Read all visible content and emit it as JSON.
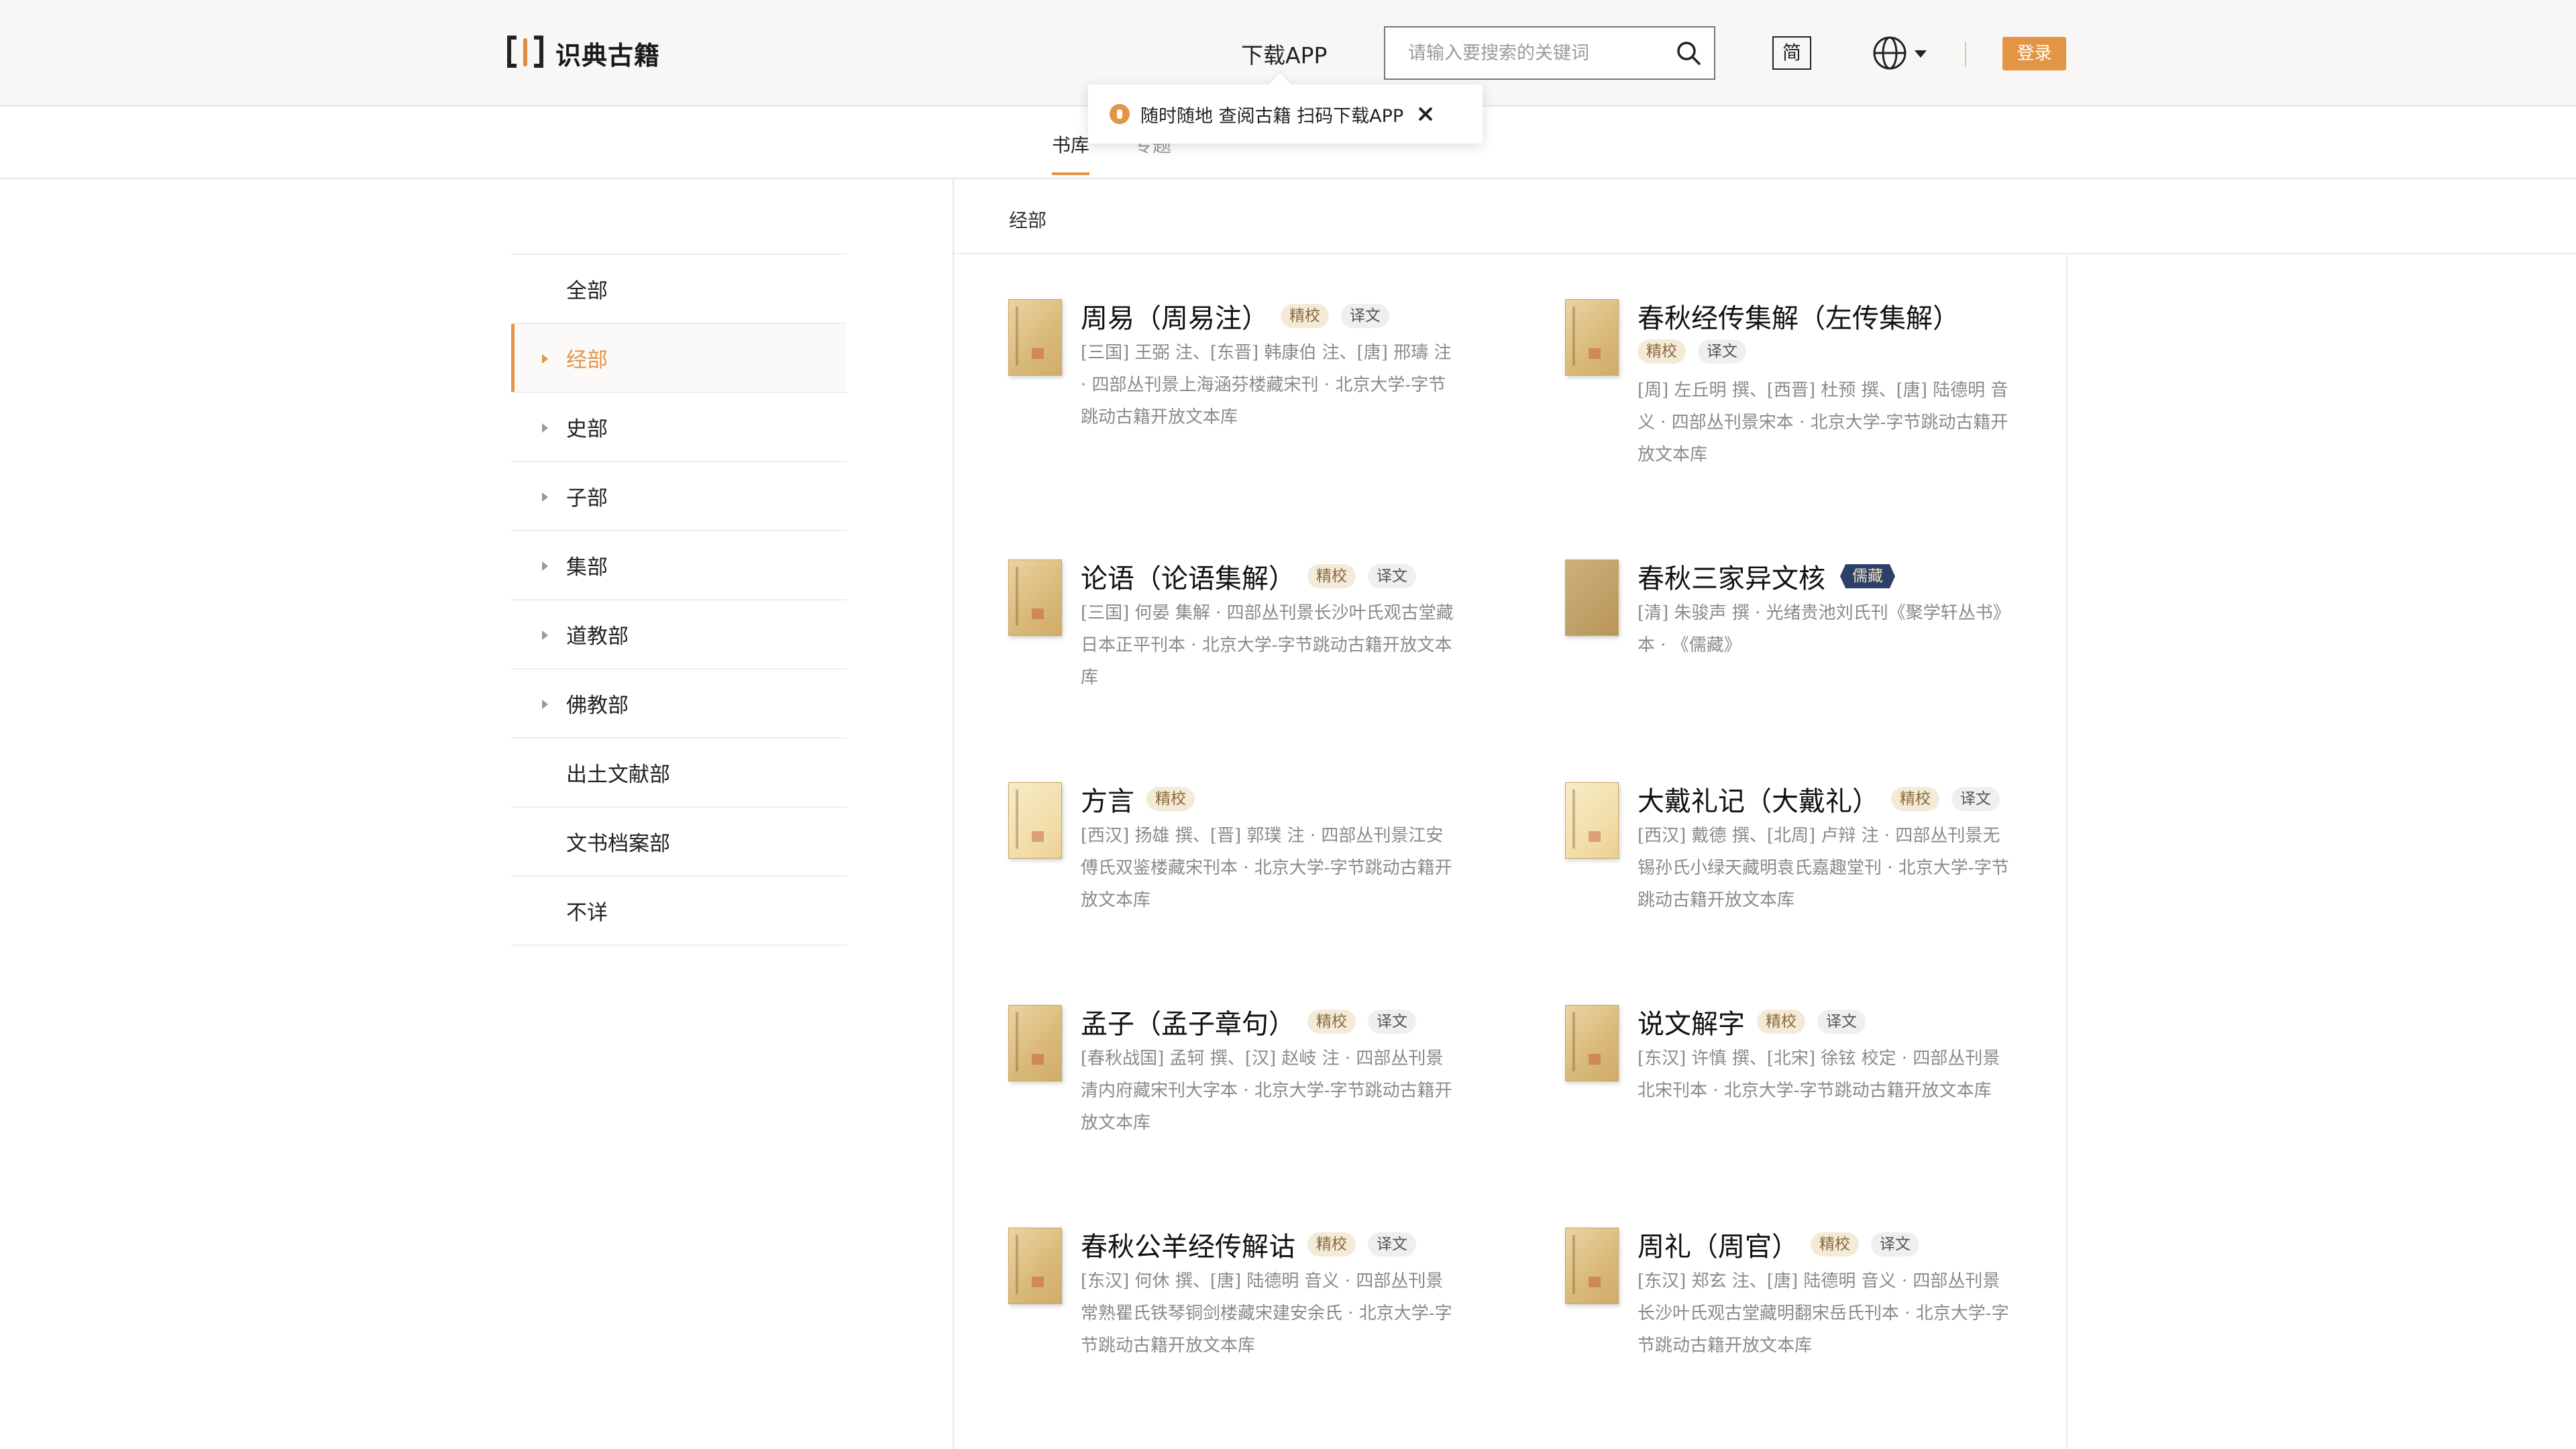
{
  "header": {
    "logo_text": "识典古籍",
    "download_label": "下载APP",
    "search_placeholder": "请输入要搜索的关键词",
    "lang_label": "简",
    "login_label": "登录"
  },
  "popup": {
    "text": "随时随地 查阅古籍 扫码下载APP"
  },
  "subnav": {
    "tabs": [
      "书库",
      "专题"
    ]
  },
  "breadcrumb": "经部",
  "sidebar": {
    "items": [
      {
        "label": "全部",
        "caret": false,
        "active": false
      },
      {
        "label": "经部",
        "caret": true,
        "active": true
      },
      {
        "label": "史部",
        "caret": true,
        "active": false
      },
      {
        "label": "子部",
        "caret": true,
        "active": false
      },
      {
        "label": "集部",
        "caret": true,
        "active": false
      },
      {
        "label": "道教部",
        "caret": true,
        "active": false
      },
      {
        "label": "佛教部",
        "caret": true,
        "active": false
      },
      {
        "label": "出土文献部",
        "caret": false,
        "active": false
      },
      {
        "label": "文书档案部",
        "caret": false,
        "active": false
      },
      {
        "label": "不详",
        "caret": false,
        "active": false
      }
    ]
  },
  "books": [
    {
      "title": "周易（周易注）",
      "tags": [
        "精校",
        "译文"
      ],
      "desc": "[三国] 王弼 注、[东晋] 韩康伯 注、[唐] 邢璹 注 · 四部丛刊景上海涵芬楼藏宋刊 · 北京大学-字节跳动古籍开放文本库"
    },
    {
      "title": "春秋经传集解（左传集解）",
      "tags": [
        "精校",
        "译文"
      ],
      "desc": "[周] 左丘明 撰、[西晋] 杜预 撰、[唐] 陆德明 音义 · 四部丛刊景宋本 · 北京大学-字节跳动古籍开放文本库"
    },
    {
      "title": "论语（论语集解）",
      "tags": [
        "精校",
        "译文"
      ],
      "desc": "[三国] 何晏 集解 · 四部丛刊景长沙叶氏观古堂藏日本正平刊本 · 北京大学-字节跳动古籍开放文本库"
    },
    {
      "title": "春秋三家异文核",
      "tags": [
        "儒藏"
      ],
      "desc": "[清] 朱骏声 撰 · 光绪贵池刘氏刊《聚学轩丛书》本 · 《儒藏》"
    },
    {
      "title": "方言",
      "tags": [
        "精校"
      ],
      "desc": "[西汉] 扬雄 撰、[晋] 郭璞 注 · 四部丛刊景江安傅氏双鉴楼藏宋刊本 · 北京大学-字节跳动古籍开放文本库"
    },
    {
      "title": "大戴礼记（大戴礼）",
      "tags": [
        "精校",
        "译文"
      ],
      "desc": "[西汉] 戴德 撰、[北周] 卢辩 注 · 四部丛刊景无锡孙氏小绿天藏明袁氏嘉趣堂刊 · 北京大学-字节跳动古籍开放文本库"
    },
    {
      "title": "孟子（孟子章句）",
      "tags": [
        "精校",
        "译文"
      ],
      "desc": "[春秋战国] 孟轲 撰、[汉] 赵岐 注 · 四部丛刊景清内府藏宋刊大字本 · 北京大学-字节跳动古籍开放文本库"
    },
    {
      "title": "说文解字",
      "tags": [
        "精校",
        "译文"
      ],
      "desc": "[东汉] 许慎 撰、[北宋] 徐铉 校定 · 四部丛刊景北宋刊本 · 北京大学-字节跳动古籍开放文本库"
    },
    {
      "title": "春秋公羊经传解诂",
      "tags": [
        "精校",
        "译文"
      ],
      "desc": "[东汉] 何休 撰、[唐] 陆德明 音义 · 四部丛刊景常熟瞿氏铁琴铜剑楼藏宋建安余氏 · 北京大学-字节跳动古籍开放文本库"
    },
    {
      "title": "周礼（周官）",
      "tags": [
        "精校",
        "译文"
      ],
      "desc": "[东汉] 郑玄 注、[唐] 陆德明 音义 · 四部丛刊景长沙叶氏观古堂藏明翻宋岳氏刊本 · 北京大学-字节跳动古籍开放文本库"
    }
  ],
  "colors": {
    "accent": "#e39444",
    "tag_jingjiao_bg": "#f4ead8",
    "tag_ruzang_bg": "#2c3e6a"
  },
  "icons": {
    "search": "search-icon",
    "globe": "globe-icon",
    "close": "close-icon"
  }
}
